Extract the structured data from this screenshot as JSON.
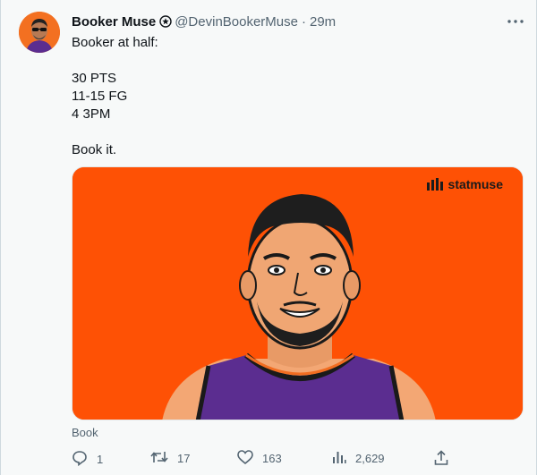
{
  "tweet": {
    "author_name": "Booker Muse",
    "handle": "@DevinBookerMuse",
    "separator": "·",
    "time": "29m",
    "lines": [
      "Booker at half:",
      "30 PTS",
      "11-15 FG",
      "4 3PM",
      "Book it."
    ],
    "media_brand": "statmuse",
    "media_caption": "Book"
  },
  "actions": {
    "replies": "1",
    "retweets": "17",
    "likes": "163",
    "views": "2,629"
  },
  "icons": {
    "verified": "badge-icon",
    "more": "more-options-icon",
    "reply": "reply-icon",
    "retweet": "retweet-icon",
    "like": "heart-icon",
    "views": "views-chart-icon",
    "share": "share-icon"
  },
  "colors": {
    "media_background": "#fe5105",
    "jersey": "#5b2d90",
    "avatar_background": "#f37021",
    "muted_text": "#536471"
  }
}
